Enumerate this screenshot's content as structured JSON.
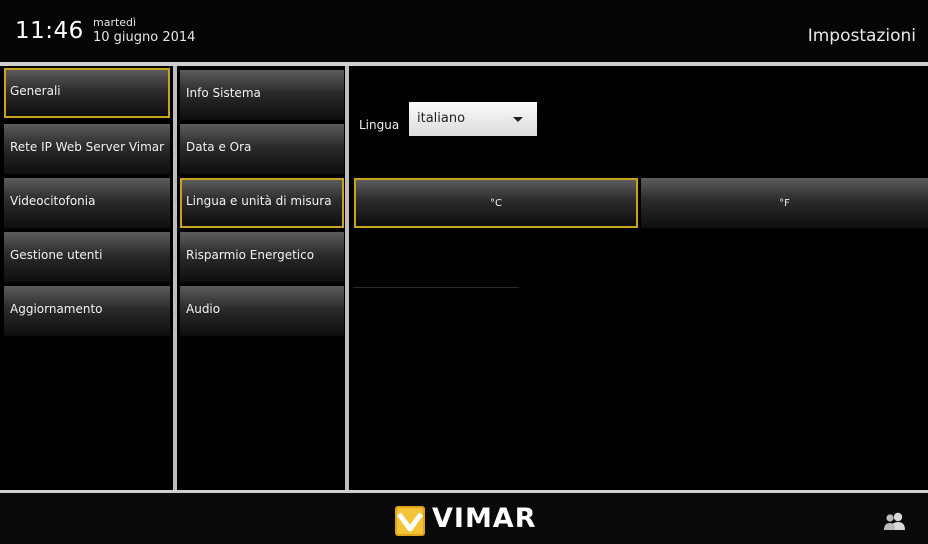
{
  "header": {
    "time": "11:46",
    "weekday": "martedì",
    "date": "10 giugno 2014",
    "title": "Impostazioni"
  },
  "menu_primary": [
    {
      "label": "Generali",
      "selected": true
    },
    {
      "label": "Rete IP Web Server Vimar",
      "selected": false
    },
    {
      "label": "Videocitofonia",
      "selected": false
    },
    {
      "label": "Gestione utenti",
      "selected": false
    },
    {
      "label": "Aggiornamento",
      "selected": false
    }
  ],
  "menu_secondary": [
    {
      "label": "Info Sistema",
      "selected": false
    },
    {
      "label": "Data e Ora",
      "selected": false
    },
    {
      "label": "Lingua e unità di misura",
      "selected": true
    },
    {
      "label": "Risparmio Energetico",
      "selected": false
    },
    {
      "label": "Audio",
      "selected": false
    }
  ],
  "content": {
    "language_label": "Lingua",
    "language_value": "italiano",
    "unit_celsius": "°C",
    "unit_fahrenheit": "°F",
    "selected_unit": "°C"
  },
  "footer": {
    "brand": "VIMAR",
    "logo_icon": "vimar-logo-icon",
    "users_icon": "users-icon"
  },
  "colors": {
    "selection_border": "#c8a41c",
    "background": "#000000",
    "separator": "#cfcfcf"
  }
}
